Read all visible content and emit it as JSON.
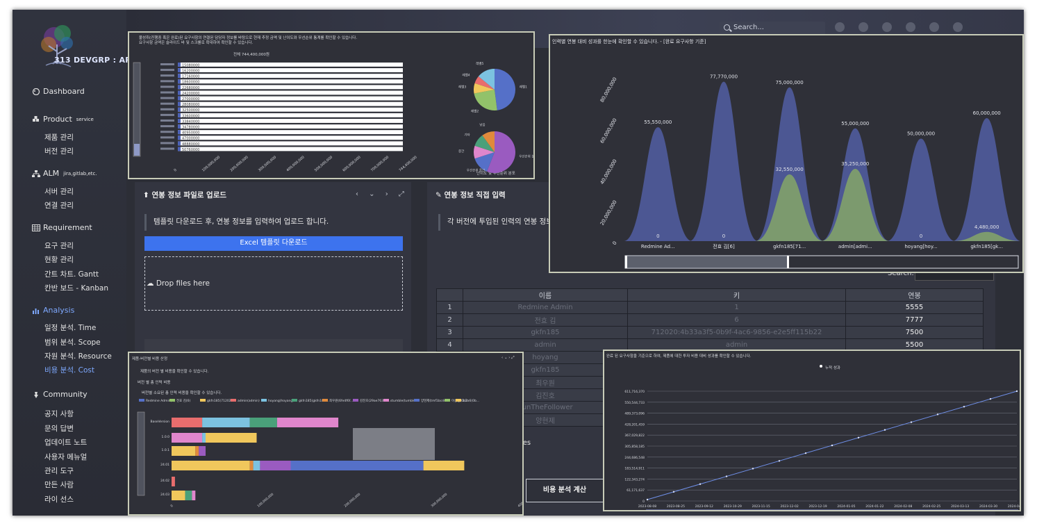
{
  "logo": {
    "text": "313 DEVGRP : ARMS"
  },
  "sidebar": {
    "dashboard": "Dashboard",
    "product": {
      "label": "Product",
      "sup": "service",
      "items": [
        "제품 관리",
        "버전 관리"
      ]
    },
    "alm": {
      "label": "ALM",
      "sup": "jira,gitlab,etc.",
      "items": [
        "서버 관리",
        "연결 관리"
      ]
    },
    "requirement": {
      "label": "Requirement",
      "items": [
        "요구 관리",
        "현황 관리",
        "간트 차트. Gantt",
        "칸반 보드 - Kanban"
      ]
    },
    "analysis": {
      "label": "Analysis",
      "items": [
        "일정 분석. Time",
        "범위 분석. Scope",
        "자원 분석. Resource",
        "비용 분석. Cost"
      ]
    },
    "community": {
      "label": "Community",
      "items": [
        "공지 사항",
        "문의 답변",
        "업데이트 노트",
        "사용자 메뉴얼",
        "관리 도구",
        "만든 사람",
        "라이 선스"
      ]
    }
  },
  "topbar": {
    "search_placeholder": "Search..."
  },
  "upload_panel": {
    "title": "연봉 정보 파일로 업로드",
    "notice": "템플릿 다운로드 후, 연봉 정보를 입력하여 업로드 합니다.",
    "download_btn": "Excel 템플릿 다운로드",
    "drop": "Drop files here"
  },
  "direct_panel": {
    "title": "연봉 정보 직접 입력",
    "notice": "각 버전에 투입된 인력의 연봉 정보",
    "search_label": "Search:",
    "entries_tail": "ies",
    "calc_btn": "비용 분석 계산"
  },
  "salary_table": {
    "headers": [
      "",
      "이름",
      "키",
      "연봉"
    ],
    "rows": [
      [
        "1",
        "Redmine Admin",
        "1",
        "5555"
      ],
      [
        "2",
        "전효 김",
        "6",
        "7777"
      ],
      [
        "3",
        "gkfn185",
        "712020:4b33a3f5-0b9f-4ac6-9856-e2e5ff115b22",
        "7500"
      ],
      [
        "4",
        "admin",
        "admin",
        "5500"
      ],
      [
        "",
        "hoyang",
        "",
        ""
      ],
      [
        "",
        "gkfn185",
        "",
        ""
      ],
      [
        "",
        "최우원",
        "",
        ""
      ],
      [
        "",
        "김진호",
        "",
        ""
      ],
      [
        "",
        "SunTheFollower",
        "",
        ""
      ],
      [
        "",
        "양현제",
        "",
        ""
      ]
    ]
  },
  "ov_top_left": {
    "desc1": "불성취(진행중 혹은 완료)된 요구사항의 연결된 담당자 정보를 바탕으로 현재 추정 금액 및 난이도와 우선순위 통계를 확인할 수 있습니다.",
    "desc2": "요구사항 금액은 슬라이드 바 및 스크롤로 확대하여 확인할 수 있습니다.",
    "chart_title": "전체 744,400,000원",
    "pie_caption": "난이도 및 우선순위 분포",
    "bar_values": [
      "15080000",
      "16200000",
      "17160000",
      "18600000",
      "22680000",
      "24200000",
      "27000000",
      "28080000",
      "32500000",
      "33600000",
      "33840000",
      "34780000",
      "40950000",
      "47000000",
      "48880000",
      "50760000"
    ],
    "x_ticks": [
      "0",
      "100,000,000",
      "200,000,000",
      "300,000,000",
      "400,000,000",
      "500,000,000",
      "600,000,000",
      "700,000,000",
      "744,400,000"
    ],
    "pie1_labels": [
      "레벨1",
      "레벨2",
      "레벨3",
      "레벨4",
      "레벨5"
    ],
    "pie2_labels": [
      "우선순위 높음",
      "우선순위 중간",
      "중간",
      "기타",
      "낮음"
    ]
  },
  "ov_top_right": {
    "title": "인력별 연봉 대비 성과를 한눈에 확인할 수 있습니다. - [완료 요구사항 기준]",
    "chart_data": {
      "type": "area",
      "categories": [
        "Redmine Ad...",
        "전효 김[6]",
        "gkfn185[71...",
        "admin[admi...",
        "hoyang[hoy...",
        "gkfn185[gk..."
      ],
      "series": [
        {
          "values": [
            55550000,
            77770000,
            75000000,
            55000000,
            50000000,
            60000000
          ]
        },
        {
          "values": [
            0,
            0,
            32550000,
            35250000,
            0,
            4480000
          ]
        }
      ],
      "value_labels": [
        [
          "55,550,000",
          "77,770,000",
          "75,000,000",
          "55,000,000",
          "50,000,000",
          "60,000,000"
        ],
        [
          "0",
          "0",
          "32,550,000",
          "35,250,000",
          "0",
          "4,480,000"
        ]
      ],
      "y_ticks": [
        "0",
        "20,000,000",
        "40,000,000",
        "60,000,000",
        "80,000,000"
      ],
      "ylim": [
        0,
        80000000
      ]
    }
  },
  "ov_bottom_left": {
    "title": "제품-버전별 비용 산정",
    "desc": "제품의 버전 별 비용을 확인할 수 있습니다.",
    "sub_title": "버전 별 총 인력 비용",
    "sub_desc": "버전별 소요된 총 인력 비용을 확인할 수 있습니다.",
    "legend": [
      "Redmine Admin(1)",
      "전효 김(6)",
      "gkfn185(712020...",
      "admin(admin)",
      "hoyang(hoyang)",
      "gkfn185(gkfn185...",
      "최우원(6fe4f6f...",
      "김진호(29ae763b9...",
      "stumble(tumble...",
      "양현제(tmf1bcd4...",
      "이승민(6b2a6(0b...",
      "1/2"
    ],
    "y_labels": [
      "BaseVersion",
      "1.0.0",
      "1.0.1",
      "24.01",
      "24.02",
      "24.03"
    ],
    "x_ticks": [
      "0",
      "100,000,000",
      "200,000,000",
      "300,000,000",
      "400,000,000"
    ]
  },
  "ov_bottom_right": {
    "title": "완료 된 요구사항을 기준으로 하여, 제품에 대한 투자 비용 대비 성과를 확인할 수 있습니다.",
    "legend": "누적 성과",
    "y_ticks": [
      "0",
      "61,171,637",
      "122,343,274",
      "183,514,911",
      "244,686,548",
      "305,858,185",
      "367,029,822",
      "428,201,459",
      "489,373,096",
      "550,544,733",
      "611,716,370"
    ],
    "x_ticks": [
      "2023-08-08",
      "2023-08-25",
      "2023-09-12",
      "2023-10-29",
      "2023-11-15",
      "2023-12-02",
      "2023-12-19",
      "2024-01-05",
      "2024-01-22",
      "2024-02-08",
      "2024-02-25",
      "2024-03-13",
      "2024-03-30",
      "2024-04-16"
    ]
  }
}
